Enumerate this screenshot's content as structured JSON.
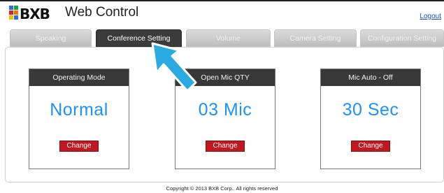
{
  "header": {
    "logo_text": "BXB",
    "title": "Web Control",
    "logout_label": "Logout"
  },
  "tabs": [
    {
      "label": "Speaking",
      "active": false
    },
    {
      "label": "Conference Setting",
      "active": true
    },
    {
      "label": "Volume",
      "active": false
    },
    {
      "label": "Camera Setting",
      "active": false
    },
    {
      "label": "Configuration Setting",
      "active": false
    }
  ],
  "cards": [
    {
      "title": "Operating Mode",
      "value": "Normal",
      "button": "Change"
    },
    {
      "title": "Open Mic QTY",
      "value": "03 Mic",
      "button": "Change"
    },
    {
      "title": "Mic Auto - Off",
      "value": "30 Sec",
      "button": "Change"
    }
  ],
  "footer": {
    "copyright": "Copyright © 2013 BXB Corp.. All rights reserved"
  },
  "colors": {
    "accent_value": "#1e90ff",
    "button_red": "#c01820",
    "tab_active": "#3b3b3b",
    "arrow": "#29abe2"
  },
  "icons": {
    "logo": "bxb-logo-icon",
    "pointer": "pointer-arrow-icon"
  }
}
